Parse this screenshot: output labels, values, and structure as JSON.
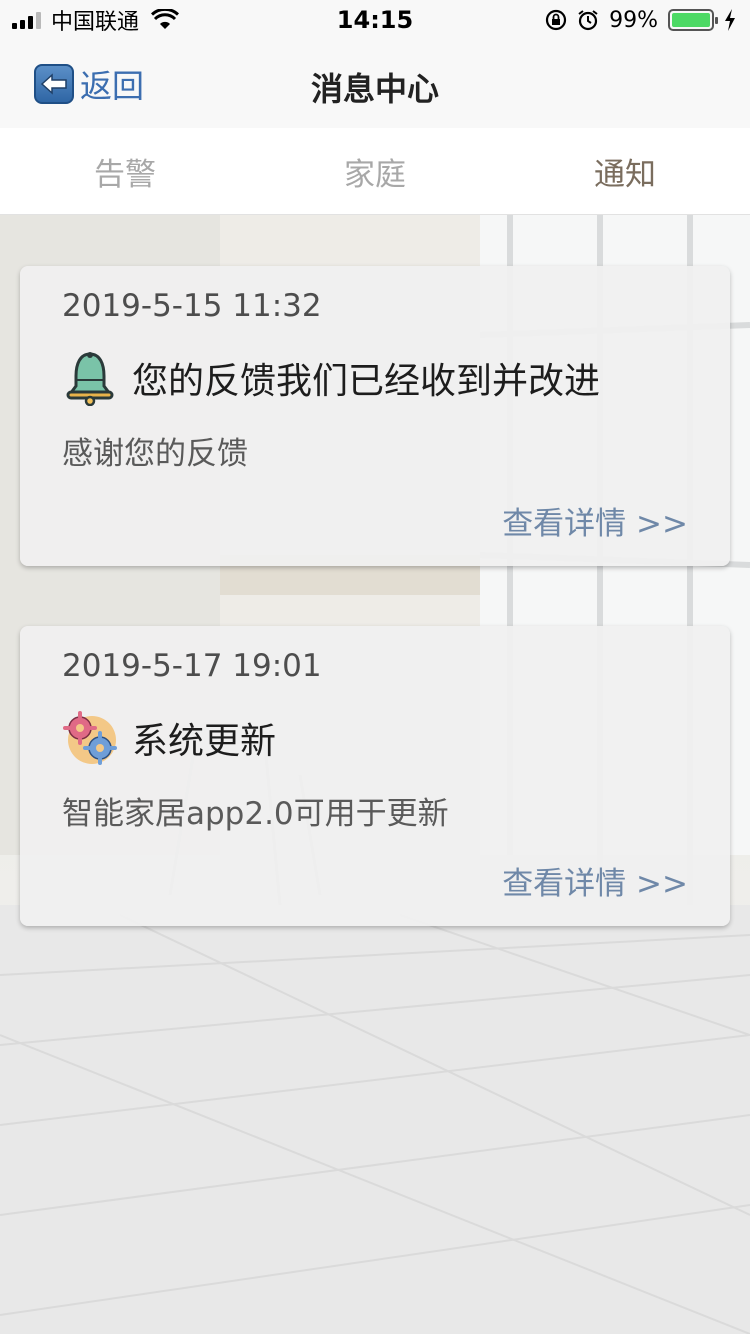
{
  "status_bar": {
    "carrier": "中国联通",
    "time": "14:15",
    "battery_percent": "99%",
    "battery_level": 0.99,
    "icons": [
      "signal-icon",
      "wifi-icon",
      "rotation-lock-icon",
      "alarm-icon",
      "battery-icon",
      "charging-icon"
    ]
  },
  "nav": {
    "back_label": "返回",
    "title": "消息中心"
  },
  "tabs": [
    {
      "label": "告警",
      "active": false
    },
    {
      "label": "家庭",
      "active": false
    },
    {
      "label": "通知",
      "active": true
    }
  ],
  "notifications": [
    {
      "time": "2019-5-15 11:32",
      "icon": "bell-icon",
      "title": "您的反馈我们已经收到并改进",
      "body": "感谢您的反馈",
      "link": "查看详情 >>"
    },
    {
      "time": "2019-5-17 19:01",
      "icon": "gears-icon",
      "title": "系统更新",
      "body": "智能家居app2.0可用于更新",
      "link": "查看详情 >>"
    }
  ],
  "colors": {
    "active_tab": "#7a6d5e",
    "inactive_tab": "#a8a8a8",
    "link": "#6f88a8",
    "back_label": "#3c6eb0"
  }
}
